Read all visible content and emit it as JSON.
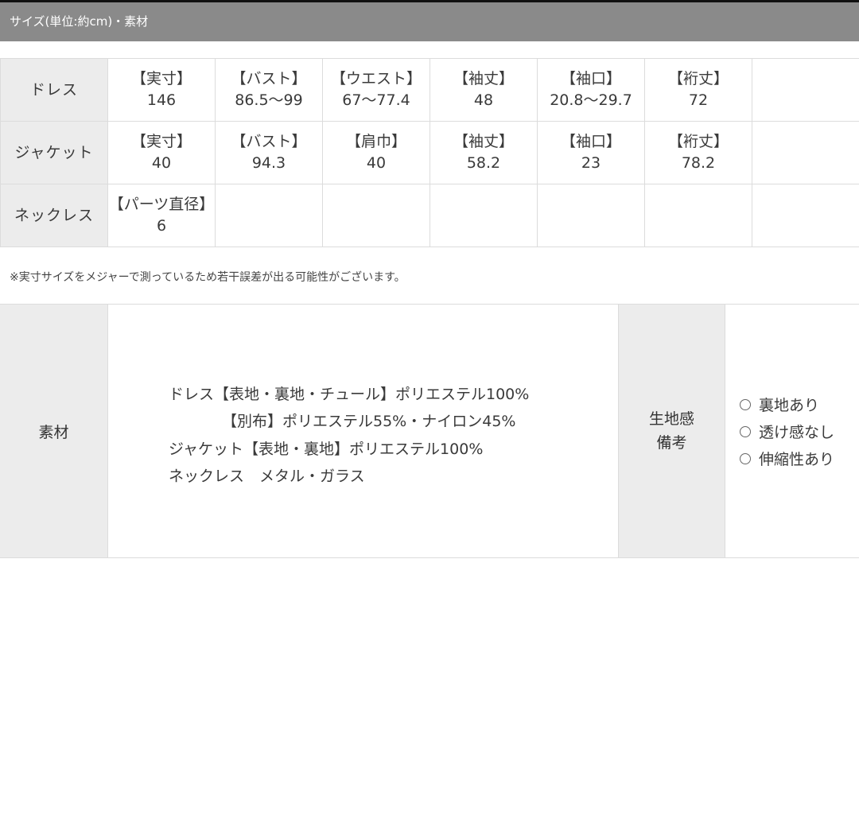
{
  "header": {
    "title": "サイズ(単位:約cm)・素材"
  },
  "size_table": {
    "rows": [
      {
        "name": "ドレス",
        "cells": [
          {
            "label": "【実寸】",
            "value": "146"
          },
          {
            "label": "【バスト】",
            "value": "86.5〜99"
          },
          {
            "label": "【ウエスト】",
            "value": "67〜77.4"
          },
          {
            "label": "【袖丈】",
            "value": "48"
          },
          {
            "label": "【袖口】",
            "value": "20.8〜29.7"
          },
          {
            "label": "【裄丈】",
            "value": "72"
          }
        ]
      },
      {
        "name": "ジャケット",
        "cells": [
          {
            "label": "【実寸】",
            "value": "40"
          },
          {
            "label": "【バスト】",
            "value": "94.3"
          },
          {
            "label": "【肩巾】",
            "value": "40"
          },
          {
            "label": "【袖丈】",
            "value": "58.2"
          },
          {
            "label": "【袖口】",
            "value": "23"
          },
          {
            "label": "【裄丈】",
            "value": "78.2"
          }
        ]
      },
      {
        "name": "ネックレス",
        "cells": [
          {
            "label": "【パーツ直径】",
            "value": "6"
          }
        ]
      }
    ]
  },
  "note": "※実寸サイズをメジャーで測っているため若干誤差が出る可能性がございます。",
  "material": {
    "heading": "素材",
    "lines": [
      "ドレス【表地・裏地・チュール】ポリエステル100%",
      "【別布】ポリエステル55%・ナイロン45%",
      "ジャケット【表地・裏地】ポリエステル100%",
      "ネックレス　メタル・ガラス"
    ]
  },
  "fabric_feel": {
    "heading_line1": "生地感",
    "heading_line2": "備考",
    "options": [
      "裏地あり",
      "透け感なし",
      "伸縮性あり"
    ]
  }
}
